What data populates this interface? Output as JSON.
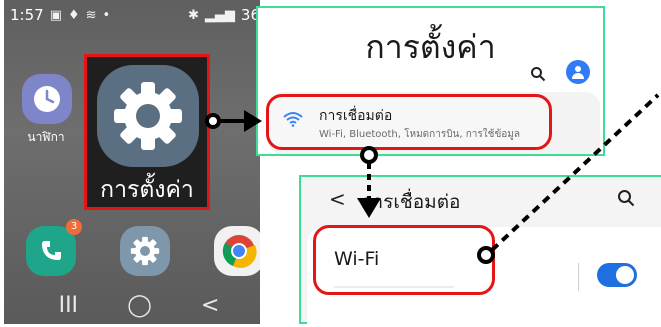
{
  "status_bar": {
    "time": "1:57",
    "right_text": "36"
  },
  "home_screen": {
    "clock_app_label": "นาฬิกา",
    "settings_app_label": "การตั้งค่า",
    "phone_badge_count": "3",
    "icons": [
      "clock-icon",
      "settings-icon",
      "phone-icon",
      "chrome-icon"
    ]
  },
  "nav_bar": {
    "recent": "III",
    "home": "◯",
    "back": "<"
  },
  "settings_screen": {
    "title": "การตั้งค่า",
    "connections_title": "การเชื่อมต่อ",
    "connections_subtitle": "Wi-Fi, Bluetooth, โหมดการบิน, การใช้ข้อมูล"
  },
  "connections_screen": {
    "title": "การเชื่อมต่อ",
    "wifi_label": "Wi-Fi",
    "wifi_enabled": true
  },
  "colors": {
    "highlight_red": "#e51515",
    "panel_border_green": "#3ddc97",
    "toggle_blue": "#1f6fe0",
    "settings_icon_slate": "#5b6f82"
  }
}
